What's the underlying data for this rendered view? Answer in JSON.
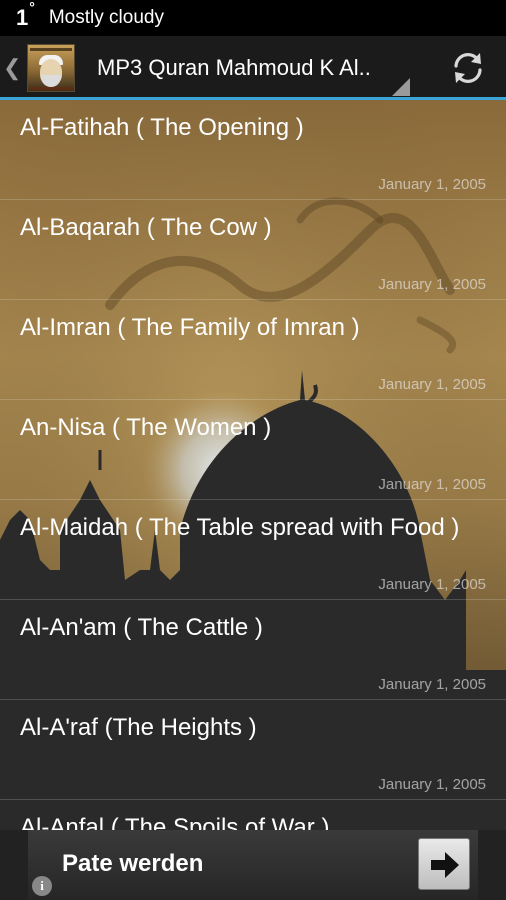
{
  "status_bar": {
    "temperature": "1",
    "degree_symbol": "°",
    "weather": "Mostly cloudy"
  },
  "action_bar": {
    "title": "MP3 Quran Mahmoud K Al..",
    "accent_color": "#3aa4d6",
    "icons": [
      "up-caret-icon",
      "app-icon",
      "dropdown-triangle-icon",
      "refresh-icon"
    ]
  },
  "surahs": [
    {
      "title": "Al-Fatihah ( The Opening )",
      "date": "January 1, 2005"
    },
    {
      "title": "Al-Baqarah ( The Cow )",
      "date": "January 1, 2005"
    },
    {
      "title": "Al-Imran ( The Family of Imran )",
      "date": "January 1, 2005"
    },
    {
      "title": "An-Nisa ( The Women )",
      "date": "January 1, 2005"
    },
    {
      "title": "Al-Maidah ( The Table spread with Food )",
      "date": "January 1, 2005"
    },
    {
      "title": "Al-An'am ( The Cattle )",
      "date": "January 1, 2005"
    },
    {
      "title": "Al-A'raf (The Heights )",
      "date": "January 1, 2005"
    },
    {
      "title": "Al-Anfal ( The Spoils of War )",
      "date": ""
    }
  ],
  "ad": {
    "text": "Pate werden",
    "info_label": "i",
    "arrow_icon": "arrow-right-icon"
  }
}
